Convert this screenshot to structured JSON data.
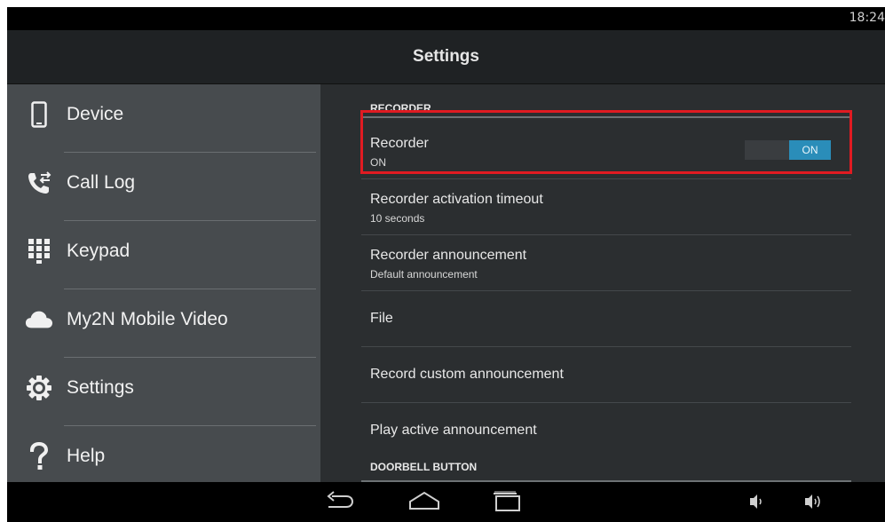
{
  "status_bar": {
    "time": "18:24"
  },
  "header": {
    "title": "Settings"
  },
  "sidebar": {
    "items": [
      {
        "label": "Device",
        "icon": "phone-device-icon"
      },
      {
        "label": "Call Log",
        "icon": "call-log-icon"
      },
      {
        "label": "Keypad",
        "icon": "keypad-icon"
      },
      {
        "label": "My2N Mobile Video",
        "icon": "cloud-icon"
      },
      {
        "label": "Settings",
        "icon": "gear-icon"
      },
      {
        "label": "Help",
        "icon": "question-icon"
      }
    ]
  },
  "content": {
    "sections": [
      {
        "header": "RECORDER"
      },
      {
        "header": "DOORBELL BUTTON"
      }
    ],
    "rows": [
      {
        "title": "Recorder",
        "subtitle": "ON",
        "toggle_label": "ON"
      },
      {
        "title": "Recorder activation timeout",
        "subtitle": "10 seconds"
      },
      {
        "title": "Recorder announcement",
        "subtitle": "Default announcement"
      },
      {
        "title": "File"
      },
      {
        "title": "Record custom announcement"
      },
      {
        "title": "Play active announcement"
      }
    ]
  },
  "colors": {
    "accent": "#2a8db9",
    "highlight": "#e01b22",
    "sidebar_bg": "#474b4e",
    "content_bg": "#2b2e30"
  },
  "nav_bar": {
    "icons": [
      "back-icon",
      "home-icon",
      "recent-apps-icon",
      "volume-down-icon",
      "volume-up-icon"
    ]
  }
}
